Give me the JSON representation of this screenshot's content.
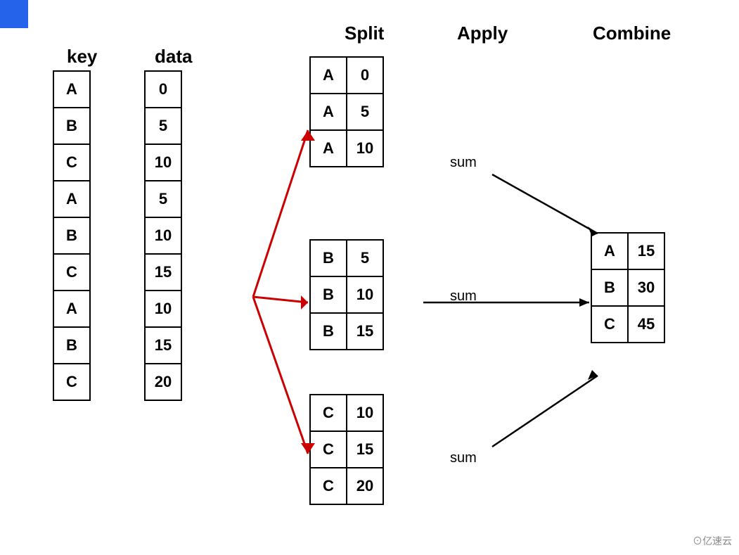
{
  "blue_corner": true,
  "headers": {
    "key": "key",
    "data": "data",
    "split": "Split",
    "apply": "Apply",
    "combine": "Combine"
  },
  "key_column": [
    "A",
    "B",
    "C",
    "A",
    "B",
    "C",
    "A",
    "B",
    "C"
  ],
  "data_column": [
    "0",
    "5",
    "10",
    "5",
    "10",
    "15",
    "10",
    "15",
    "20"
  ],
  "split_a": [
    [
      "A",
      "0"
    ],
    [
      "A",
      "5"
    ],
    [
      "A",
      "10"
    ]
  ],
  "split_b": [
    [
      "B",
      "5"
    ],
    [
      "B",
      "10"
    ],
    [
      "B",
      "15"
    ]
  ],
  "split_c": [
    [
      "C",
      "10"
    ],
    [
      "C",
      "15"
    ],
    [
      "C",
      "20"
    ]
  ],
  "result": [
    [
      "A",
      "15"
    ],
    [
      "B",
      "30"
    ],
    [
      "C",
      "45"
    ]
  ],
  "sum_labels": [
    "sum",
    "sum",
    "sum"
  ],
  "watermark": "⊙亿速云"
}
